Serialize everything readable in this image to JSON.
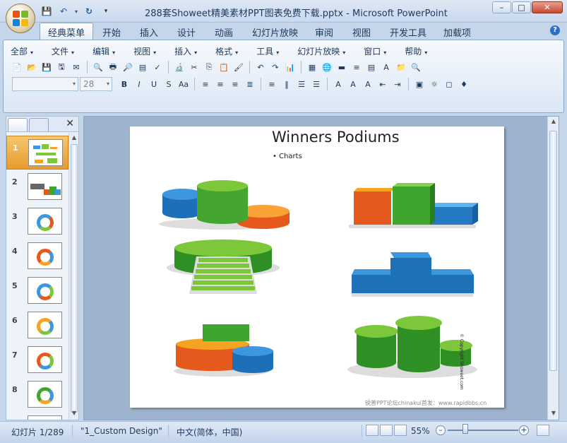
{
  "window": {
    "title": "288套Showeet精美素材PPT图表免费下载.pptx - Microsoft PowerPoint",
    "controls": {
      "minimize": "–",
      "maximize": "□",
      "close": "✕"
    }
  },
  "quick_access": {
    "save": "💾",
    "undo": "↶",
    "undo_caret": "▾",
    "redo": "↻",
    "customize": "▾"
  },
  "ribbon_tabs": [
    "经典菜单",
    "开始",
    "插入",
    "设计",
    "动画",
    "幻灯片放映",
    "审阅",
    "视图",
    "开发工具",
    "加载项"
  ],
  "help": "?",
  "classic_menu": [
    "全部",
    "文件",
    "编辑",
    "视图",
    "插入",
    "格式",
    "工具",
    "幻灯片放映",
    "窗口",
    "帮助"
  ],
  "menu_caret": "▾",
  "font_box": {
    "family": "",
    "size": "28",
    "caret": "▾"
  },
  "toolbar1_icons": [
    "📄",
    "📂",
    "💾",
    "🖫",
    "✉",
    "🔍",
    "🖶",
    "🔎",
    "▤",
    "✓",
    "🔬",
    "✂",
    "⎘",
    "📋",
    "🖌",
    "↶",
    "↷",
    "📊",
    "▦",
    "🌐",
    "▬",
    "≡",
    "▤",
    "A",
    "📁",
    "🔍"
  ],
  "toolbar2_icons": [
    "B",
    "I",
    "U",
    "S",
    "Aa",
    "≡",
    "≡",
    "≡",
    "≣",
    "≡",
    "‖",
    "☰",
    "☰",
    "A",
    "A",
    "A",
    "⇤",
    "⇥",
    "▣",
    "☼",
    "◻",
    "♦"
  ],
  "panel": {
    "close": "✕",
    "up": "▲",
    "down": "▼"
  },
  "slides": [
    {
      "num": "1"
    },
    {
      "num": "2"
    },
    {
      "num": "3"
    },
    {
      "num": "4"
    },
    {
      "num": "5"
    },
    {
      "num": "6"
    },
    {
      "num": "7"
    },
    {
      "num": "8"
    },
    {
      "num": "9"
    }
  ],
  "slide": {
    "title": "Winners Podiums",
    "bullet": "Charts",
    "bullet_mark": "•",
    "copyright": "© Copyright Showeet.com",
    "watermark": "锐普PPT论坛chinakui首发：www.rapidbbs.cn"
  },
  "editor_scroll": {
    "up": "▲",
    "down": "▼"
  },
  "status": {
    "slide_counter": "幻灯片 1/289",
    "theme": "\"1_Custom Design\"",
    "language": "中文(简体，中国)",
    "zoom": "55%",
    "zoom_out": "–",
    "zoom_in": "+"
  },
  "colors": {
    "blue": "#2479c2",
    "green": "#3ea52d",
    "orange": "#e55a1c",
    "yellow": "#f6a324",
    "ribbon": "#dbe7f5",
    "selected_thumb": "#e79a2b"
  }
}
